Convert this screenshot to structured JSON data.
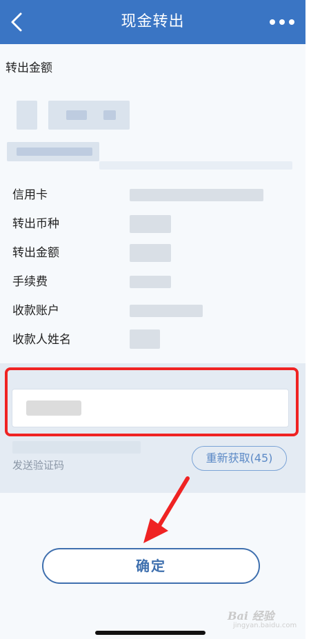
{
  "header": {
    "title": "现金转出",
    "back_icon": "chevron-left-icon",
    "more_icon": "more-horizontal-icon",
    "color": "#3a75c4"
  },
  "section": {
    "title": "转出金额"
  },
  "details": {
    "rows": [
      {
        "label": "信用卡"
      },
      {
        "label": "转出币种"
      },
      {
        "label": "转出金额"
      },
      {
        "label": "手续费"
      },
      {
        "label": "收款账户"
      },
      {
        "label": "收款人姓名"
      }
    ]
  },
  "verify": {
    "send_hint": "发送验证码",
    "resend_label": "重新获取(45)",
    "highlight_color": "#ef2323"
  },
  "confirm": {
    "label": "确定"
  },
  "watermark": {
    "brand": "Bai 经验",
    "sub": "jingyan.baidu.com"
  }
}
